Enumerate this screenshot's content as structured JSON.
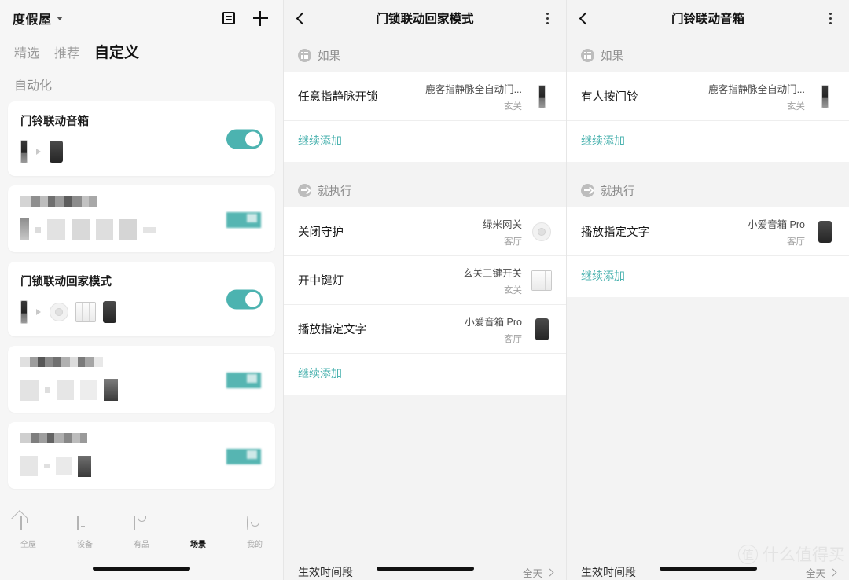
{
  "left": {
    "home_name": "度假屋",
    "icons": {
      "list": "list-box-icon",
      "add": "plus-icon"
    },
    "tabs": [
      {
        "label": "精选",
        "active": false
      },
      {
        "label": "推荐",
        "active": false
      },
      {
        "label": "自定义",
        "active": true
      }
    ],
    "section_label": "自动化",
    "cards": [
      {
        "title": "门铃联动音箱",
        "blurred": false,
        "toggle_on": true,
        "devices": [
          "door-lock",
          "arrow",
          "speaker"
        ]
      },
      {
        "title": "",
        "blurred": true,
        "toggle_on": true,
        "devices": []
      },
      {
        "title": "门锁联动回家模式",
        "blurred": false,
        "toggle_on": true,
        "devices": [
          "door-lock",
          "arrow",
          "gateway",
          "switch3",
          "speaker"
        ]
      },
      {
        "title": "",
        "blurred": true,
        "toggle_on": true,
        "devices": []
      },
      {
        "title": "",
        "blurred": true,
        "toggle_on": true,
        "devices": []
      }
    ],
    "nav": [
      {
        "label": "全屋",
        "icon": "home-icon",
        "active": false
      },
      {
        "label": "设备",
        "icon": "device-icon",
        "active": false
      },
      {
        "label": "有品",
        "icon": "shop-bag-icon",
        "active": false
      },
      {
        "label": "场景",
        "icon": "scene-hexagon-icon",
        "active": true
      },
      {
        "label": "我的",
        "icon": "profile-smiley-icon",
        "active": false
      }
    ]
  },
  "mid": {
    "title": "门锁联动回家模式",
    "back_icon": "chevron-left-icon",
    "menu_icon": "kebab-menu-icon",
    "trigger_section": {
      "title": "如果",
      "icon": "list-circle-icon"
    },
    "triggers": [
      {
        "name": "任意指静脉开锁",
        "device": "鹿客指静脉全自动门...",
        "room": "玄关",
        "thumb": "door-lock"
      }
    ],
    "trigger_add": "继续添加",
    "action_section": {
      "title": "就执行",
      "icon": "arrow-circle-icon"
    },
    "actions": [
      {
        "name": "关闭守护",
        "device": "绿米网关",
        "room": "客厅",
        "thumb": "gateway"
      },
      {
        "name": "开中键灯",
        "device": "玄关三键开关",
        "room": "玄关",
        "thumb": "switch3"
      },
      {
        "name": "播放指定文字",
        "device": "小爱音箱 Pro",
        "room": "客厅",
        "thumb": "speaker"
      }
    ],
    "action_add": "继续添加",
    "footer": {
      "label": "生效时间段",
      "value": "全天",
      "chevron": "chevron-right-icon"
    }
  },
  "right": {
    "title": "门铃联动音箱",
    "back_icon": "chevron-left-icon",
    "menu_icon": "kebab-menu-icon",
    "trigger_section": {
      "title": "如果",
      "icon": "list-circle-icon"
    },
    "triggers": [
      {
        "name": "有人按门铃",
        "device": "鹿客指静脉全自动门...",
        "room": "玄关",
        "thumb": "door-lock"
      }
    ],
    "trigger_add": "继续添加",
    "action_section": {
      "title": "就执行",
      "icon": "arrow-circle-icon"
    },
    "actions": [
      {
        "name": "播放指定文字",
        "device": "小爱音箱 Pro",
        "room": "客厅",
        "thumb": "speaker"
      }
    ],
    "action_add": "继续添加",
    "footer": {
      "label": "生效时间段",
      "value": "全天",
      "chevron": "chevron-right-icon"
    }
  },
  "watermark": {
    "badge": "值",
    "text": "什么值得买"
  },
  "colors": {
    "accent": "#4cb3b0",
    "link": "#4cb3b0",
    "panel_bg": "#f3f3f3",
    "card_bg": "#ffffff"
  }
}
